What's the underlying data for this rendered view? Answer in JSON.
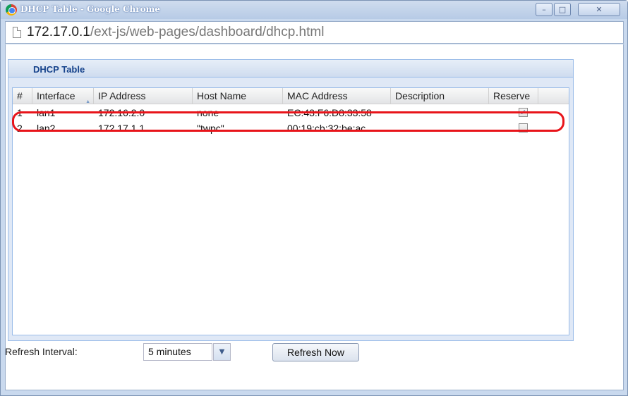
{
  "window": {
    "title": "DHCP Table - Google Chrome",
    "controls": {
      "minimize": "–",
      "maximize": "□",
      "close": "✕"
    }
  },
  "address_bar": {
    "host": "172.17.0.1",
    "path": "/ext-js/web-pages/dashboard/dhcp.html"
  },
  "panel": {
    "title": "DHCP Table"
  },
  "table": {
    "columns": [
      "#",
      "Interface",
      "IP Address",
      "Host Name",
      "MAC Address",
      "Description",
      "Reserve"
    ],
    "sort_column": "Interface",
    "rows": [
      {
        "num": "1",
        "interface": "lan1",
        "ip": "172.16.2.0",
        "host": "none",
        "mac": "EC:43:F6:D8:33:58",
        "description": "",
        "reserve": true
      },
      {
        "num": "2",
        "interface": "lan2",
        "ip": "172.17.1.1",
        "host": "\"twpc\"",
        "mac": "00:19:cb:32:be:ac",
        "description": "",
        "reserve": false
      }
    ],
    "highlighted_row": 0,
    "highlight_color": "#e8141a"
  },
  "controls": {
    "refresh_interval_label": "Refresh Interval:",
    "refresh_interval_value": "5 minutes",
    "refresh_button": "Refresh Now"
  },
  "colors": {
    "panel_title": "#15428b",
    "panel_border": "#99bbe8"
  },
  "icons": [
    "chrome-logo-icon",
    "page-icon",
    "chevron-down-icon",
    "sort-asc-icon",
    "checkbox-icon"
  ]
}
